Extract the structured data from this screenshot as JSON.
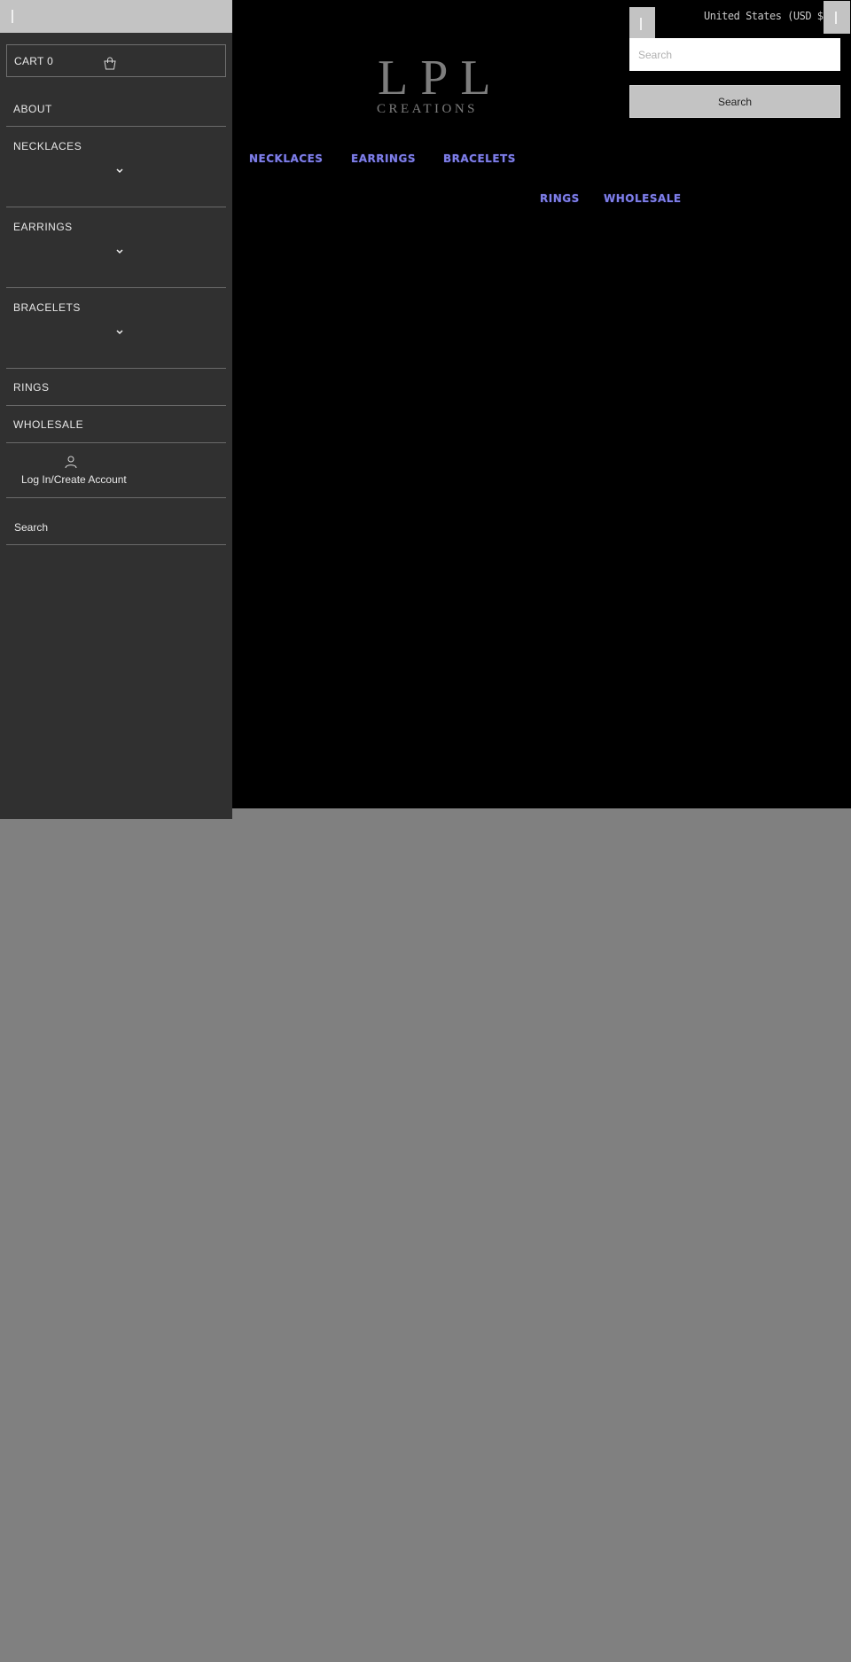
{
  "sidebar": {
    "cart_label": "CART 0",
    "items": [
      {
        "label": "ABOUT",
        "has_dropdown": false
      },
      {
        "label": "NECKLACES",
        "has_dropdown": true
      },
      {
        "label": "EARRINGS",
        "has_dropdown": true
      },
      {
        "label": "BRACELETS",
        "has_dropdown": true
      },
      {
        "label": "RINGS",
        "has_dropdown": false
      },
      {
        "label": "WHOLESALE",
        "has_dropdown": false
      }
    ],
    "login_label": "Log In/Create Account",
    "search_label": "Search"
  },
  "header": {
    "logo": {
      "main": "LPL",
      "sub": "CREATIONS"
    },
    "currency_label": "United States (USD $)",
    "search": {
      "placeholder": "Search",
      "value": "",
      "button_label": "Search"
    },
    "nav": [
      {
        "label": "NECKLACES"
      },
      {
        "label": "EARRINGS"
      },
      {
        "label": "BRACELETS"
      },
      {
        "label": "RINGS"
      },
      {
        "label": "WHOLESALE"
      }
    ]
  },
  "colors": {
    "sidebar_bg": "#303030",
    "header_bg": "#000000",
    "page_bg": "#808080",
    "nav_link": "#7f7fe8",
    "button_bg": "#c3c3c3"
  }
}
